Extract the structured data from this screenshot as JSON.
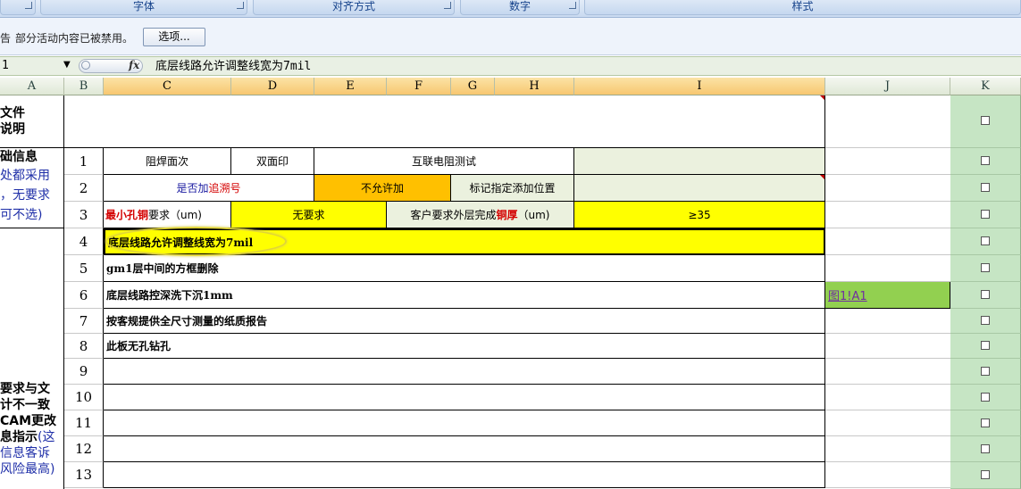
{
  "ribbon": {
    "groups": [
      "字体",
      "对齐方式",
      "数字",
      "样式"
    ]
  },
  "security": {
    "icon_text": "告",
    "message": "部分活动内容已被禁用。",
    "options_button": "选项..."
  },
  "formula_bar": {
    "name_box": "1",
    "fx_label": "fx",
    "content": "底层线路允许调整线宽为7mil"
  },
  "columns": [
    "A",
    "B",
    "C",
    "D",
    "E",
    "F",
    "G",
    "H",
    "I",
    "J",
    "K"
  ],
  "colA": {
    "file_title_1": "文件",
    "file_title_2": "说明",
    "basic_1": "础信息",
    "basic_2": "处都采用",
    "basic_3": "，无要求",
    "basic_4": "可不选)",
    "req_1": "要求与文",
    "req_2": "计不一致",
    "req_3": "CAM更改",
    "req_4a": "息指示",
    "req_4b": "(这",
    "req_5": "信息客诉",
    "req_6": "风险最高)"
  },
  "rows": {
    "r1": {
      "num": "1",
      "c": "阻焊面次",
      "d": "双面印",
      "ef": "互联电阻测试"
    },
    "r2": {
      "num": "2",
      "c_a": "是否加",
      "c_b": "追溯号",
      "e": "不允许加",
      "g": "标记指定添加位置"
    },
    "r3": {
      "num": "3",
      "c_a": "最小孔铜",
      "c_b": "要求（um)",
      "d": "无要求",
      "g_a": "客户要求外层完成",
      "g_b": "铜厚",
      "g_c": "（um)",
      "i": "≥35"
    },
    "r4": {
      "num": "4",
      "text": "底层线路允许调整线宽为7mil"
    },
    "r5": {
      "num": "5",
      "text": "gm1层中间的方框删除"
    },
    "r6": {
      "num": "6",
      "text": "底层线路控深洗下沉1mm",
      "link": "图1!A1"
    },
    "r7": {
      "num": "7",
      "text": "按客规提供全尺寸测量的纸质报告"
    },
    "r8": {
      "num": "8",
      "text": "此板无孔钻孔"
    },
    "r9": {
      "num": "9"
    },
    "r10": {
      "num": "10"
    },
    "r11": {
      "num": "11"
    },
    "r12": {
      "num": "12"
    },
    "r13": {
      "num": "13"
    }
  },
  "colors": {
    "highlight_yellow": "#ffff00",
    "orange": "#ffc000",
    "pale_green": "#ebf1de",
    "link_green": "#92d050",
    "k_column": "#c6e5c4"
  }
}
